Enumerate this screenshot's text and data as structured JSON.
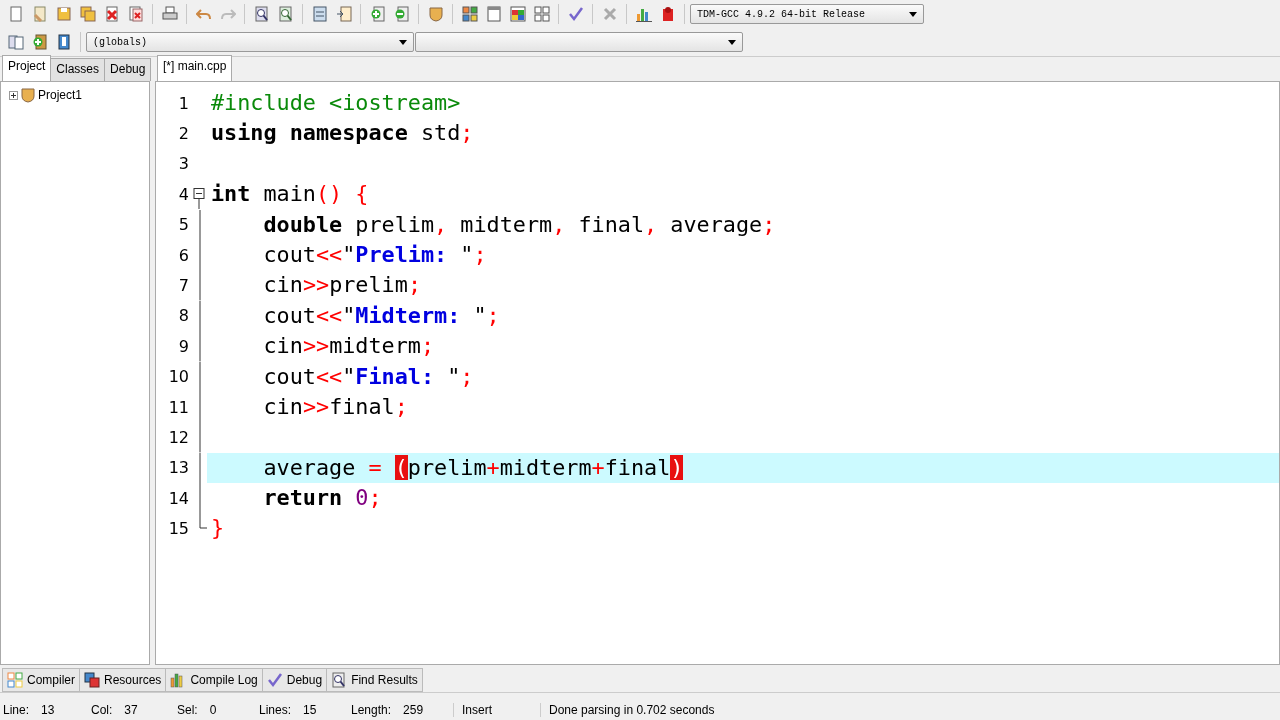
{
  "toolbar": {
    "compiler": "TDM-GCC 4.9.2 64-bit Release",
    "scope": "(globals)"
  },
  "sidebar": {
    "tabs": [
      {
        "label": "Project",
        "selected": true
      },
      {
        "label": "Classes",
        "selected": false
      },
      {
        "label": "Debug",
        "selected": false
      }
    ],
    "tree": [
      {
        "label": "Project1",
        "expanded": false
      }
    ]
  },
  "editor": {
    "tabs": [
      {
        "label": "[*] main.cpp",
        "selected": true
      }
    ],
    "lines": [
      {
        "number": "1",
        "current": false,
        "tokens": [
          {
            "text": "#include <iostream>",
            "kind": "pre"
          }
        ]
      },
      {
        "number": "2",
        "current": false,
        "tokens": [
          {
            "text": "using namespace",
            "kind": "kw"
          },
          {
            "text": " std",
            "kind": "plain"
          },
          {
            "text": ";",
            "kind": "op"
          }
        ]
      },
      {
        "number": "3",
        "current": false
      },
      {
        "number": "4",
        "current": false,
        "fold_expanded": true,
        "tokens": [
          {
            "text": "int",
            "kind": "kw"
          },
          {
            "text": " main",
            "kind": "plain"
          },
          {
            "text": "()",
            "kind": "op"
          },
          {
            "text": " {",
            "kind": "op"
          }
        ]
      },
      {
        "number": "5",
        "current": false,
        "tokens": [
          {
            "text": "    double",
            "kind": "kw"
          },
          {
            "text": " prelim",
            "kind": "plain"
          },
          {
            "text": ",",
            "kind": "op"
          },
          {
            "text": " midterm",
            "kind": "plain"
          },
          {
            "text": ",",
            "kind": "op"
          },
          {
            "text": " final",
            "kind": "plain"
          },
          {
            "text": ",",
            "kind": "op"
          },
          {
            "text": " average",
            "kind": "plain"
          },
          {
            "text": ";",
            "kind": "op"
          }
        ]
      },
      {
        "number": "6",
        "current": false,
        "tokens": [
          {
            "text": "    cout",
            "kind": "plain"
          },
          {
            "text": "<<",
            "kind": "op"
          },
          {
            "text": "\"",
            "kind": "plain"
          },
          {
            "text": "Prelim: ",
            "kind": "str"
          },
          {
            "text": "\"",
            "kind": "plain"
          },
          {
            "text": ";",
            "kind": "op"
          }
        ]
      },
      {
        "number": "7",
        "current": false,
        "tokens": [
          {
            "text": "    cin",
            "kind": "plain"
          },
          {
            "text": ">>",
            "kind": "op"
          },
          {
            "text": "prelim",
            "kind": "plain"
          },
          {
            "text": ";",
            "kind": "op"
          }
        ]
      },
      {
        "number": "8",
        "current": false,
        "tokens": [
          {
            "text": "    cout",
            "kind": "plain"
          },
          {
            "text": "<<",
            "kind": "op"
          },
          {
            "text": "\"",
            "kind": "plain"
          },
          {
            "text": "Midterm: ",
            "kind": "str"
          },
          {
            "text": "\"",
            "kind": "plain"
          },
          {
            "text": ";",
            "kind": "op"
          }
        ]
      },
      {
        "number": "9",
        "current": false,
        "tokens": [
          {
            "text": "    cin",
            "kind": "plain"
          },
          {
            "text": ">>",
            "kind": "op"
          },
          {
            "text": "midterm",
            "kind": "plain"
          },
          {
            "text": ";",
            "kind": "op"
          }
        ]
      },
      {
        "number": "10",
        "current": false,
        "tokens": [
          {
            "text": "    cout",
            "kind": "plain"
          },
          {
            "text": "<<",
            "kind": "op"
          },
          {
            "text": "\"",
            "kind": "plain"
          },
          {
            "text": "Final: ",
            "kind": "str"
          },
          {
            "text": "\"",
            "kind": "plain"
          },
          {
            "text": ";",
            "kind": "op"
          }
        ]
      },
      {
        "number": "11",
        "current": false,
        "tokens": [
          {
            "text": "    cin",
            "kind": "plain"
          },
          {
            "text": ">>",
            "kind": "op"
          },
          {
            "text": "final",
            "kind": "plain"
          },
          {
            "text": ";",
            "kind": "op"
          }
        ]
      },
      {
        "number": "12",
        "current": false
      },
      {
        "number": "13",
        "current": true,
        "tokens": [
          {
            "text": "    average ",
            "kind": "plain"
          },
          {
            "text": "= ",
            "kind": "op"
          },
          {
            "text": "(",
            "kind": "match"
          },
          {
            "text": "prelim",
            "kind": "plain"
          },
          {
            "text": "+",
            "kind": "op"
          },
          {
            "text": "midterm",
            "kind": "plain"
          },
          {
            "text": "+",
            "kind": "op"
          },
          {
            "text": "final",
            "kind": "plain"
          },
          {
            "text": ")",
            "kind": "match"
          }
        ]
      },
      {
        "number": "14",
        "current": false,
        "tokens": [
          {
            "text": "    return ",
            "kind": "kw"
          },
          {
            "text": "0",
            "kind": "num"
          },
          {
            "text": ";",
            "kind": "op"
          }
        ]
      },
      {
        "number": "15",
        "current": false,
        "tokens": [
          {
            "text": "}",
            "kind": "op"
          }
        ]
      }
    ]
  },
  "bottom_tabs": [
    {
      "label": "Compiler",
      "selected": false
    },
    {
      "label": "Resources",
      "selected": false
    },
    {
      "label": "Compile Log",
      "selected": false
    },
    {
      "label": "Debug",
      "selected": false
    },
    {
      "label": "Find Results",
      "selected": false
    }
  ],
  "status_bar": [
    {
      "label": "Line:",
      "value": "13"
    },
    {
      "label": "Col:",
      "value": "37"
    },
    {
      "label": "Sel:",
      "value": "0"
    },
    {
      "label": "Lines:",
      "value": "15"
    },
    {
      "label": "Length:",
      "value": "259"
    },
    {
      "label": "Insert"
    },
    {
      "label": "Done parsing in 0.702 seconds"
    }
  ]
}
